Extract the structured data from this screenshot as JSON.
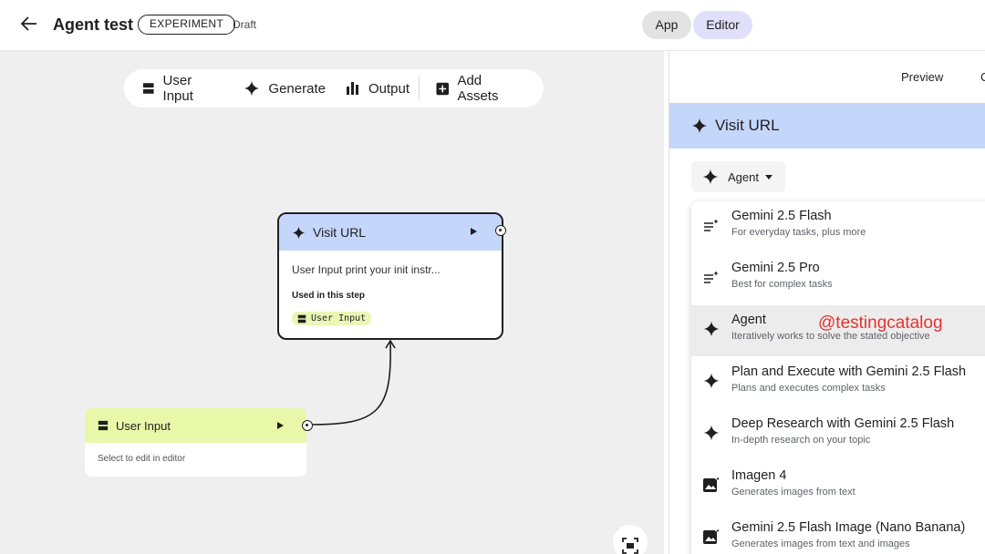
{
  "header": {
    "title": "Agent test",
    "badge": "EXPERIMENT",
    "status": "Draft",
    "segments": [
      "App",
      "Editor"
    ],
    "active_segment": "Editor"
  },
  "toolbar": {
    "user_input": "User Input",
    "generate": "Generate",
    "output": "Output",
    "add_assets": "Add Assets"
  },
  "nodes": {
    "visit_url": {
      "title": "Visit URL",
      "body": "User Input print your init instr...",
      "used_label": "Used in this step",
      "chip": "User Input"
    },
    "user_input": {
      "title": "User Input",
      "body": "Select to edit in editor"
    }
  },
  "panel": {
    "preview": "Preview",
    "cut_text": "C",
    "step_title": "Visit URL",
    "selector_value": "Agent",
    "options": [
      {
        "title": "Gemini 2.5 Flash",
        "subtitle": "For everyday tasks, plus more",
        "icon": "list-sparkle-icon"
      },
      {
        "title": "Gemini 2.5 Pro",
        "subtitle": "Best for complex tasks",
        "icon": "list-sparkle-icon"
      },
      {
        "title": "Agent",
        "subtitle": "Iteratively works to solve the stated objective",
        "icon": "sparkle-icon",
        "watermark": "@testingcatalog"
      },
      {
        "title": "Plan and Execute with Gemini 2.5 Flash",
        "subtitle": "Plans and executes complex tasks",
        "icon": "sparkle-icon"
      },
      {
        "title": "Deep Research with Gemini 2.5 Flash",
        "subtitle": "In-depth research on your topic",
        "icon": "sparkle-icon"
      },
      {
        "title": "Imagen 4",
        "subtitle": "Generates images from text",
        "icon": "image-sparkle-icon"
      },
      {
        "title": "Gemini 2.5 Flash Image (Nano Banana)",
        "subtitle": "Generates images from text and images",
        "icon": "image-sparkle-icon"
      }
    ],
    "selected_option": "Agent"
  },
  "colors": {
    "node_blue": "#c5d6fb",
    "node_green": "#e9f7a8",
    "editor_active": "#e1e0fb",
    "watermark": "#e8322f"
  }
}
